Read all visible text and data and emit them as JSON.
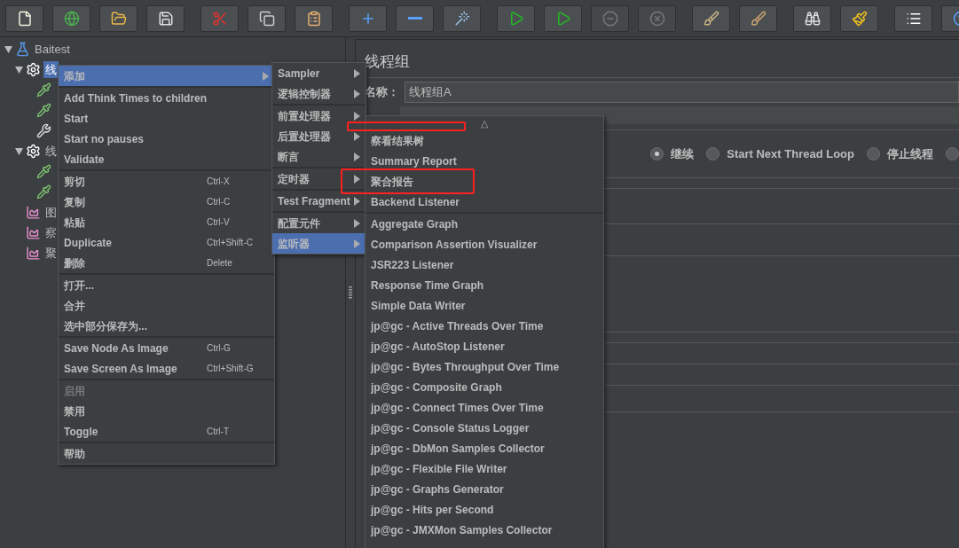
{
  "toolbar": {
    "groups": [
      [
        {
          "kind": "new"
        },
        {
          "kind": "templates"
        },
        {
          "kind": "open"
        },
        {
          "kind": "save"
        }
      ],
      [
        {
          "kind": "cut"
        },
        {
          "kind": "copy"
        },
        {
          "kind": "paste"
        }
      ],
      [
        {
          "kind": "expand"
        },
        {
          "kind": "collapse"
        },
        {
          "kind": "toggle"
        }
      ],
      [
        {
          "kind": "start",
          "disabled": false
        },
        {
          "kind": "start-no-pause",
          "disabled": false
        },
        {
          "kind": "stop",
          "disabled": true
        },
        {
          "kind": "shutdown",
          "disabled": true
        }
      ],
      [
        {
          "kind": "clear"
        },
        {
          "kind": "clear-all"
        }
      ],
      [
        {
          "kind": "search"
        },
        {
          "kind": "reset"
        }
      ],
      [
        {
          "kind": "log"
        },
        {
          "kind": "help"
        }
      ]
    ]
  },
  "tree": [
    {
      "label": "Baitest",
      "kind": "plan",
      "expanded": true,
      "selected": false,
      "children": [
        {
          "label": "线",
          "kind": "group",
          "expanded": true,
          "selected": true,
          "children": [
            {
              "kind": "sampler"
            },
            {
              "kind": "sampler"
            },
            {
              "kind": "config"
            }
          ]
        },
        {
          "label": "线",
          "kind": "group",
          "expanded": true,
          "selected": false,
          "children": [
            {
              "kind": "sampler"
            },
            {
              "kind": "sampler"
            }
          ]
        },
        {
          "label": "图",
          "kind": "listener"
        },
        {
          "label": "察",
          "kind": "listener"
        },
        {
          "label": "聚",
          "kind": "listener"
        }
      ]
    }
  ],
  "panel": {
    "title": "线程组",
    "name_label": "名称：",
    "name_value": "线程组A",
    "on_error": [
      {
        "label": "继续",
        "selected": true
      },
      {
        "label": "Start Next Thread Loop",
        "selected": false
      },
      {
        "label": "停止线程",
        "selected": false
      },
      {
        "selected": false
      }
    ]
  },
  "context_menu": {
    "sections": [
      [
        {
          "label": "添加",
          "submenu": true,
          "selected": true
        }
      ],
      [
        {
          "label": "Add Think Times to children"
        },
        {
          "label": "Start"
        },
        {
          "label": "Start no pauses"
        },
        {
          "label": "Validate"
        }
      ],
      [
        {
          "label": "剪切",
          "shortcut": "Ctrl-X"
        },
        {
          "label": "复制",
          "shortcut": "Ctrl-C"
        },
        {
          "label": "粘贴",
          "shortcut": "Ctrl-V"
        },
        {
          "label": "Duplicate",
          "shortcut": "Ctrl+Shift-C"
        },
        {
          "label": "删除",
          "shortcut": "Delete"
        }
      ],
      [
        {
          "label": "打开..."
        },
        {
          "label": "合并"
        },
        {
          "label": "选中部分保存为..."
        }
      ],
      [
        {
          "label": "Save Node As Image",
          "shortcut": "Ctrl-G"
        },
        {
          "label": "Save Screen As Image",
          "shortcut": "Ctrl+Shift-G"
        }
      ],
      [
        {
          "label": "启用",
          "disabled": true
        },
        {
          "label": "禁用"
        },
        {
          "label": "Toggle",
          "shortcut": "Ctrl-T"
        }
      ],
      [
        {
          "label": "帮助"
        }
      ]
    ]
  },
  "add_menu": {
    "sections": [
      [
        {
          "label": "Sampler",
          "submenu": true
        },
        {
          "label": "逻辑控制器",
          "submenu": true
        }
      ],
      [
        {
          "label": "前置处理器",
          "submenu": true
        },
        {
          "label": "后置处理器",
          "submenu": true
        },
        {
          "label": "断言",
          "submenu": true
        }
      ],
      [
        {
          "label": "定时器",
          "submenu": true
        }
      ],
      [
        {
          "label": "Test Fragment",
          "submenu": true
        }
      ],
      [
        {
          "label": "配置元件",
          "submenu": true
        },
        {
          "label": "监听器",
          "submenu": true,
          "selected": true
        }
      ]
    ]
  },
  "listener_menu": {
    "scroll_up": "△",
    "sections": [
      [
        {
          "label": "察看结果树"
        },
        {
          "label": "Summary Report"
        },
        {
          "label": "聚合报告"
        },
        {
          "label": "Backend Listener"
        }
      ],
      [
        {
          "label": "Aggregate Graph"
        },
        {
          "label": "Comparison Assertion Visualizer"
        },
        {
          "label": "JSR223 Listener"
        },
        {
          "label": "Response Time Graph"
        },
        {
          "label": "Simple Data Writer"
        },
        {
          "label": "jp@gc - Active Threads Over Time"
        },
        {
          "label": "jp@gc - AutoStop Listener"
        },
        {
          "label": "jp@gc - Bytes Throughput Over Time"
        },
        {
          "label": "jp@gc - Composite Graph"
        },
        {
          "label": "jp@gc - Connect Times Over Time"
        },
        {
          "label": "jp@gc - Console Status Logger"
        },
        {
          "label": "jp@gc - DbMon Samples Collector"
        },
        {
          "label": "jp@gc - Flexible File Writer"
        },
        {
          "label": "jp@gc - Graphs Generator"
        },
        {
          "label": "jp@gc - Hits per Second"
        },
        {
          "label": "jp@gc - JMXMon Samples Collector"
        }
      ]
    ]
  },
  "annotations": [
    {
      "kind": "box"
    },
    {
      "kind": "box"
    }
  ]
}
